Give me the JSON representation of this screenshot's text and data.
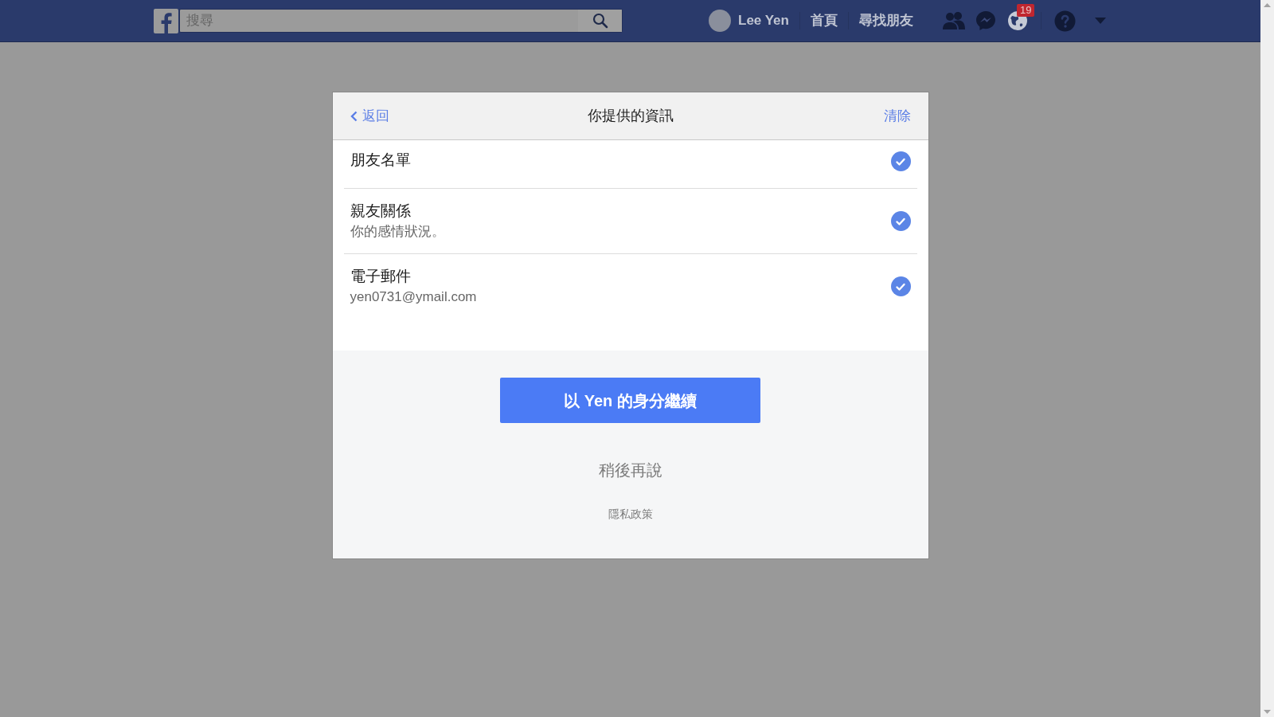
{
  "top_bar": {
    "search": {
      "placeholder": "搜尋"
    },
    "profile": {
      "name": "Lee Yen"
    },
    "nav": [
      "首頁",
      "尋找朋友"
    ],
    "notification_count": "19"
  },
  "dialog": {
    "back": "返回",
    "title": "你提供的資訊",
    "clear": "清除",
    "items": [
      {
        "title": "朋友名單",
        "checked": true
      },
      {
        "title": "親友關係",
        "subtitle": "你的感情狀況。",
        "checked": true
      },
      {
        "title": "電子郵件",
        "subtitle": "yen0731@ymail.com",
        "checked": true
      }
    ],
    "continue_button": "以 Yen 的身分繼續",
    "later": "稍後再說",
    "privacy": "隱私政策"
  }
}
